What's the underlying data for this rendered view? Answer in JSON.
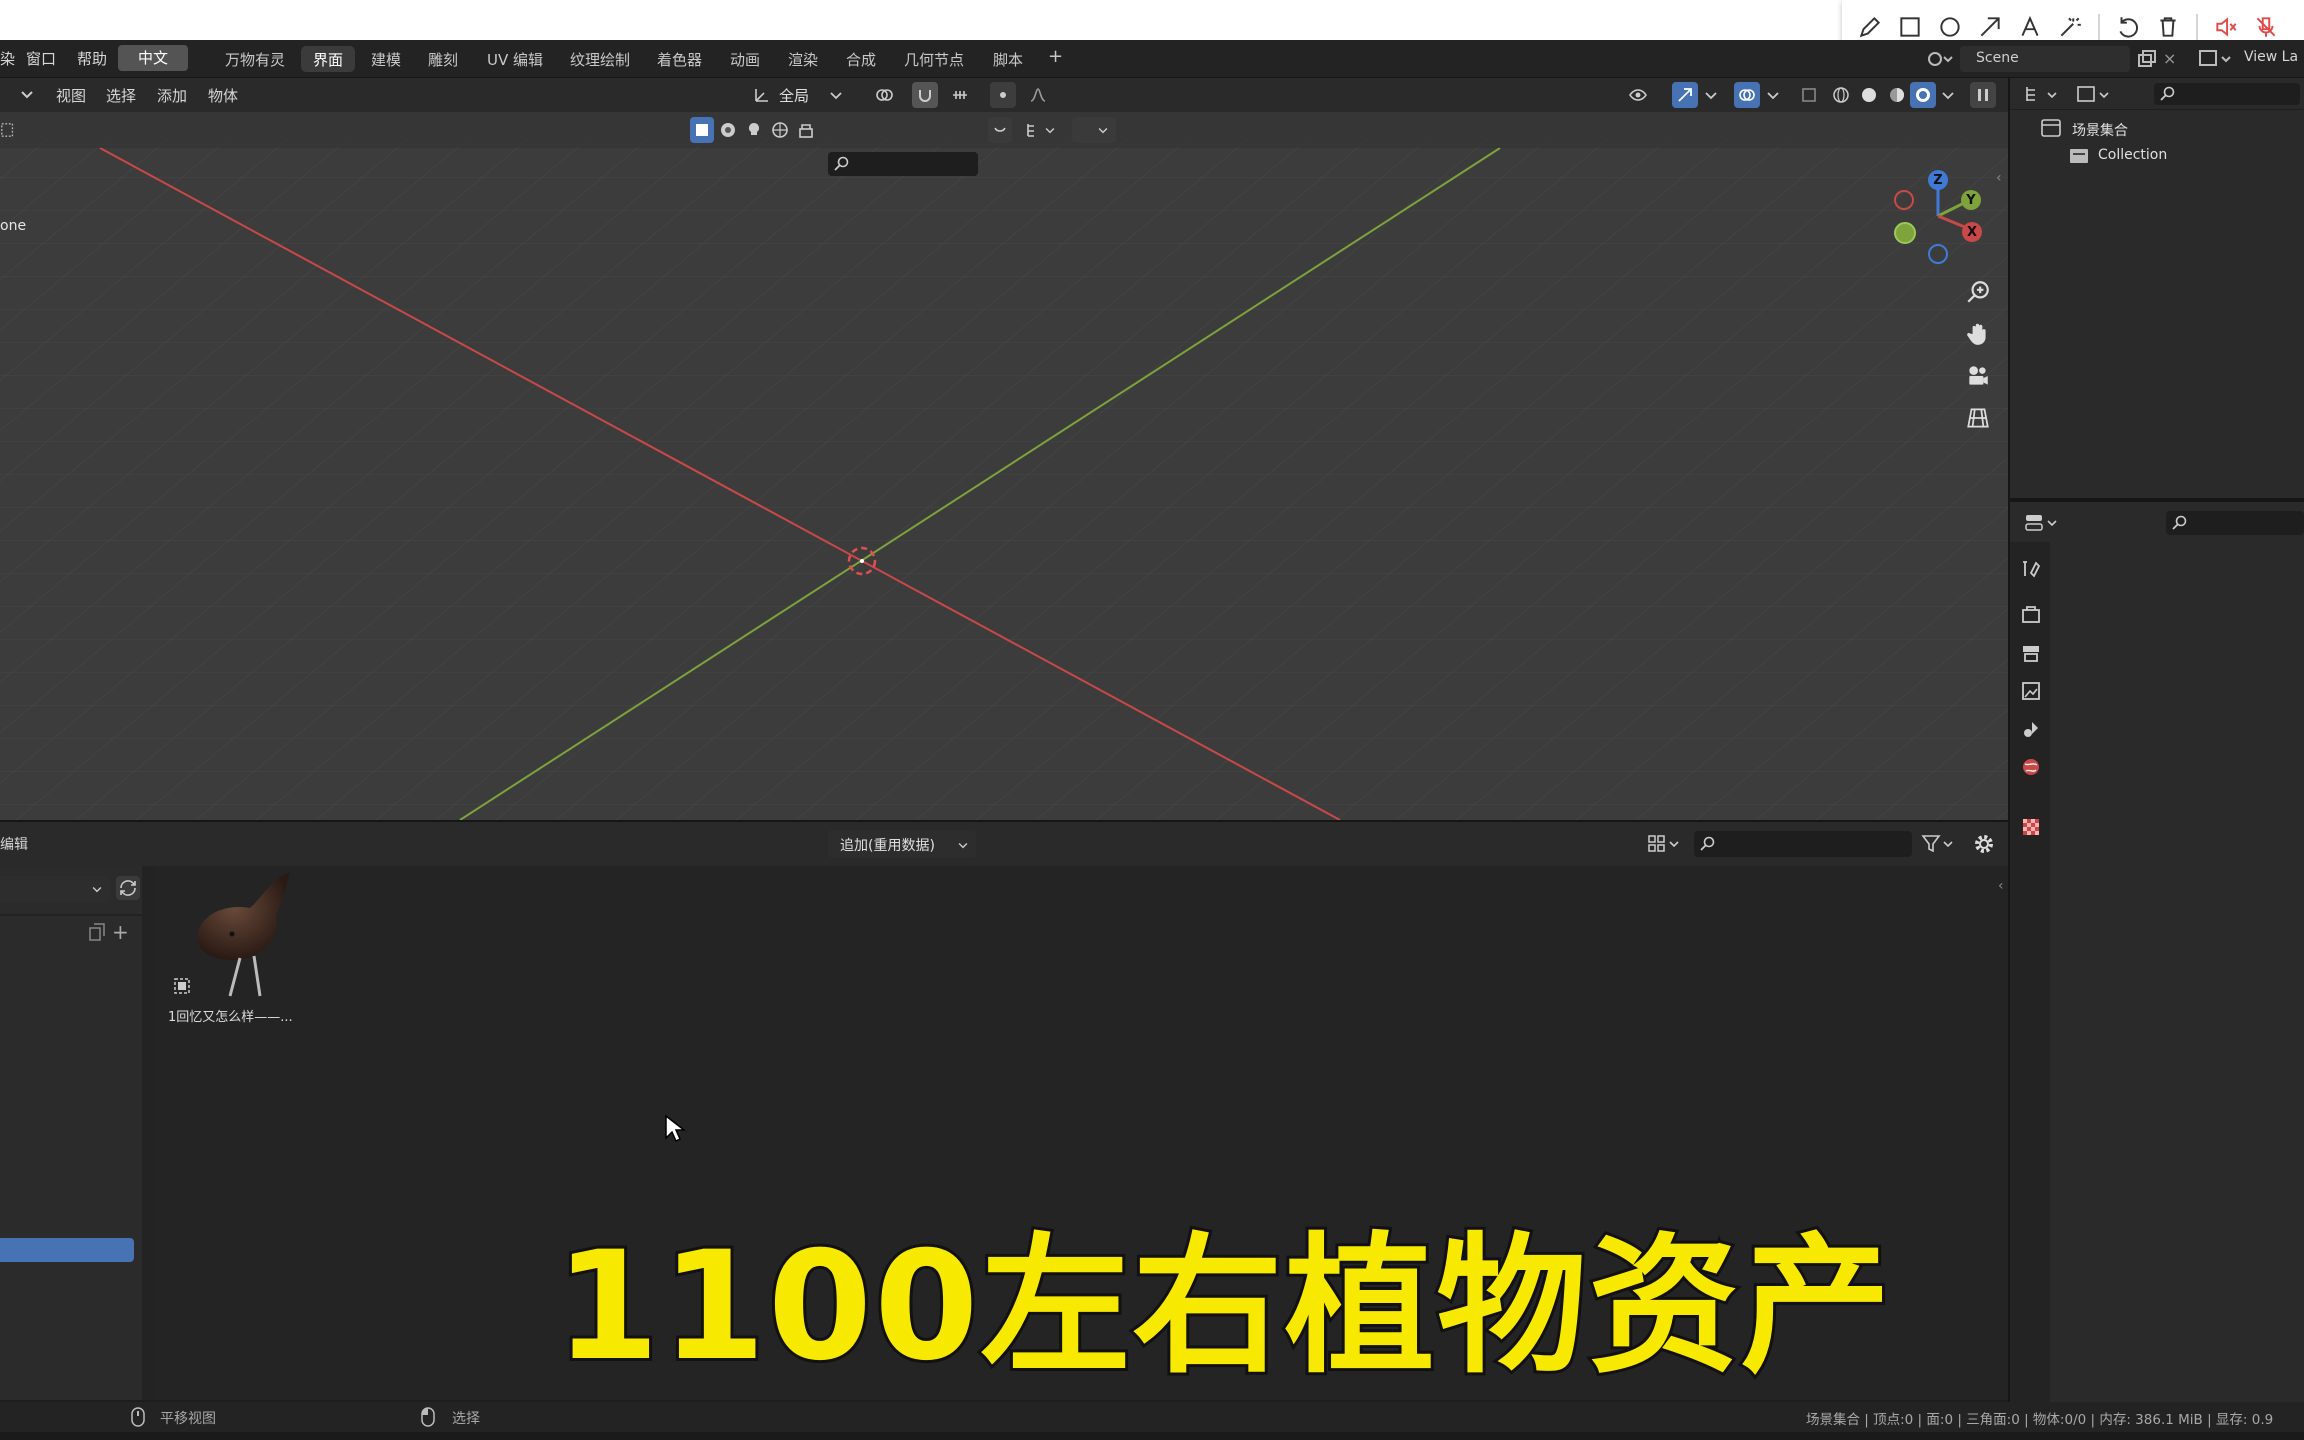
{
  "window": {
    "menu": [
      "窗口",
      "帮助"
    ],
    "menu_prefix": "染",
    "language_button": "中文",
    "workspaces": [
      "万物有灵",
      "界面",
      "建模",
      "雕刻",
      "UV 编辑",
      "纹理绘制",
      "着色器",
      "动画",
      "渲染",
      "合成",
      "几何节点",
      "脚本"
    ],
    "active_workspace": "界面",
    "add_workspace": "+",
    "scene_name": "Scene",
    "view_layer": "View La"
  },
  "viewport": {
    "menus": [
      "视图",
      "选择",
      "添加",
      "物体"
    ],
    "transform_orientation": "全局",
    "overlay_text_partial": "one",
    "colors": {
      "x_axis": "#c94848",
      "y_axis": "#7da33a",
      "z_axis": "#3f7bd6",
      "bg": "#3c3c3c"
    }
  },
  "gizmo": {
    "x": "X",
    "y": "Y",
    "z": "Z"
  },
  "asset_browser": {
    "editor_label": "编辑",
    "import_mode": "追加(重用数据)",
    "assets": [
      {
        "name": "1回忆又怎么样——..."
      }
    ]
  },
  "outliner": {
    "scene_collection": "场景集合",
    "collection": "Collection"
  },
  "status_bar": {
    "left_hint_1": "平移视图",
    "left_hint_2": "选择",
    "stats": "场景集合 | 顶点:0 | 面:0 | 三角面:0 | 物体:0/0 | 内存: 386.1 MiB | 显存: 0.9"
  },
  "subtitle": "1100左右植物资产",
  "annotation_toolbar": {
    "icons": [
      "pencil-icon",
      "rectangle-icon",
      "circle-icon",
      "arrow-icon",
      "text-icon",
      "magic-wand-icon",
      "undo-icon",
      "trash-icon",
      "speaker-muted-icon",
      "mic-muted-icon"
    ]
  }
}
